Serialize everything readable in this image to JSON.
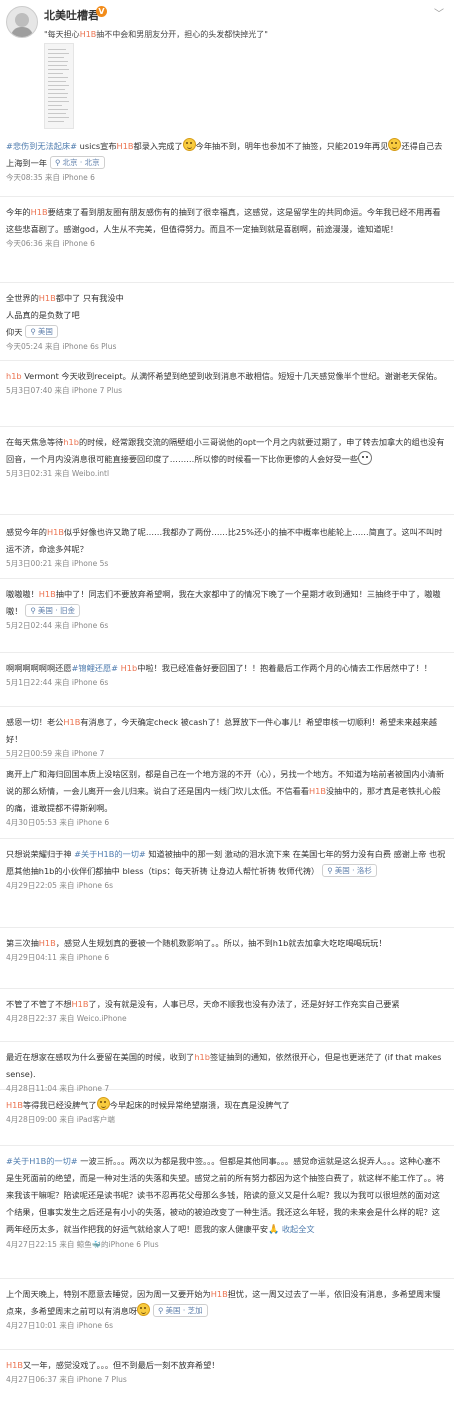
{
  "header": {
    "username": "北美吐槽君",
    "verified_badge": "V",
    "quote_before": "\"每天担心",
    "quote_highlight": "H1B",
    "quote_after": "抽不中会和男朋友分开，担心的头发都快掉光了\""
  },
  "posts": [
    {
      "parts": [
        {
          "t": "#悲伤到无法起床#",
          "c": "topic"
        },
        {
          "t": " usics宣布"
        },
        {
          "t": "H1B",
          "c": "tag"
        },
        {
          "t": "都录入完成了"
        },
        {
          "emoji": "sad"
        },
        {
          "t": "今年抽不到，明年也参加不了抽签，只能2019年再见"
        },
        {
          "emoji": "sad"
        },
        {
          "t": "还得自己去上海到一年"
        }
      ],
      "location": "北京 · 北京",
      "meta": "今天08:35 来自 iPhone 6"
    },
    {
      "parts": [
        {
          "t": "今年的"
        },
        {
          "t": "H1B",
          "c": "tag"
        },
        {
          "t": "要结束了看到朋友圈有朋友感伤有的抽到了很幸福真，这感觉，这是留学生的共同命运。今年我已经不用再看这些悲喜剧了。感谢god，人生从不完美，但值得努力。而且不一定抽到就是喜剧啊，前途漫漫，谁知道呢！"
        }
      ],
      "meta": "今天06:36 来自 iPhone 6"
    },
    {
      "parts": [
        {
          "t": "全世界的"
        },
        {
          "t": "H1B",
          "c": "tag"
        },
        {
          "t": "都中了 只有我没中\n人品真的是负数了吧\n仰天"
        }
      ],
      "location": "美国",
      "meta": "今天05:24 来自 iPhone 6s Plus"
    },
    {
      "parts": [
        {
          "t": "h1b",
          "c": "tag"
        },
        {
          "t": " Vermont 今天收到receipt。从满怀希望到绝望到收到消息不敢相信。短短十几天感觉像半个世纪。谢谢老天保佑。"
        }
      ],
      "meta": "5月3日07:40 来自 iPhone 7 Plus"
    },
    {
      "parts": [
        {
          "t": "在每天焦急等待"
        },
        {
          "t": "h1b",
          "c": "tag"
        },
        {
          "t": "的时候，经常跟我交流的隔壁组小三哥说他的opt一个月之内就要过期了，申了转去加拿大的组也没有回音，一个月内没消息很可能直接要回印度了………所以惨的时候看一下比你更惨的人会好受一些"
        },
        {
          "emoji": "face"
        }
      ],
      "meta": "5月3日02:31 来自 Weibo.intl"
    },
    {
      "parts": [
        {
          "t": "感觉今年的"
        },
        {
          "t": "H1B",
          "c": "tag"
        },
        {
          "t": "似乎好像也许又跪了呢……我都办了两份……比25%还小的抽不中概率也能轮上……简直了。这叫不叫时运不济，命途多舛呢？"
        }
      ],
      "meta": "5月3日00:21 来自 iPhone 5s"
    },
    {
      "parts": [
        {
          "t": "嗷嗷嗷！"
        },
        {
          "t": "H1B",
          "c": "tag"
        },
        {
          "t": "抽中了！同志们不要放弃希望啊，我在大家都中了的情况下晚了一个星期才收到通知！三抽终于中了，嗷嗷嗷！"
        }
      ],
      "location": "美国 · 旧金",
      "meta": "5月2日02:44 来自 iPhone 6s"
    },
    {
      "parts": [
        {
          "t": "啊啊啊啊啊啊还愿"
        },
        {
          "t": "#锦鲤还愿#",
          "c": "topic"
        },
        {
          "t": " "
        },
        {
          "t": "H1b",
          "c": "tag"
        },
        {
          "t": "中啦！我已经准备好要回国了！！抱着最后工作两个月的心情去工作居然中了！！"
        }
      ],
      "meta": "5月1日22:44 来自 iPhone 6s"
    },
    {
      "parts": [
        {
          "t": "感恩一切！老公"
        },
        {
          "t": "H1B",
          "c": "tag"
        },
        {
          "t": "有消息了，今天确定check 被cash了！总算放下一件心事儿！希望审核一切顺利！希望未来越来越好！"
        }
      ],
      "meta": "5月2日00:59 来自 iPhone 7"
    },
    {
      "parts": [
        {
          "t": "离开上广和海归回国本质上没啥区别，都是自己在一个地方混的不开（心），另找一个地方。不知道为啥前者被国内小清新说的那么矫情，一会儿离开一会儿归来。说白了还是国内一线门坎儿太低。不信看看"
        },
        {
          "t": "H1B",
          "c": "tag"
        },
        {
          "t": "没抽中的，那才真是老铁扎心般的痛，谁敢提都不得斯剁啊。"
        }
      ],
      "meta": "4月30日05:53 来自 iPhone 6"
    },
    {
      "parts": [
        {
          "t": "只想说荣耀归于神 "
        },
        {
          "t": "#关于H1B的一切#",
          "c": "topic"
        },
        {
          "t": " 知道被抽中的那一刻 激动的泪水流下来 在美国七年的努力没有白费 感谢上帝 也祝愿其他抽h1b的小伙伴们都抽中 bless（tips：每天祈祷 让身边人帮忙祈祷 牧师代祷）"
        }
      ],
      "location": "美国 · 洛杉",
      "meta": "4月29日22:05 来自 iPhone 6s"
    },
    {
      "parts": [
        {
          "t": "第三次抽"
        },
        {
          "t": "H1B",
          "c": "tag"
        },
        {
          "t": "，感觉人生规划真的要被一个随机数影响了。。所以，抽不到h1b就去加拿大吃吃喝喝玩玩！"
        }
      ],
      "meta": "4月29日04:11 来自 iPhone 6"
    },
    {
      "parts": [
        {
          "t": "不管了不管了不想"
        },
        {
          "t": "H1B",
          "c": "tag"
        },
        {
          "t": "了，没有就是没有，人事已尽，天命不顺我也没有办法了，还是好好工作充实自己要紧"
        }
      ],
      "meta": "4月28日22:37 来自 Weico.iPhone"
    },
    {
      "parts": [
        {
          "t": "最近在想家在感叹为什么要留在美国的时候，收到了"
        },
        {
          "t": "h1b",
          "c": "tag"
        },
        {
          "t": "签证抽到的通知，依然很开心，但是也更迷茫了 (if that makes sense)."
        }
      ],
      "meta": "4月28日11:04 来自 iPhone 7"
    },
    {
      "parts": [
        {
          "t": "H1B",
          "c": "tag"
        },
        {
          "t": "等得我已经没脾气了"
        },
        {
          "emoji": "sad"
        },
        {
          "t": "今早起床的时候异常绝望崩溃，现在真是没脾气了"
        }
      ],
      "meta": "4月28日09:00 来自 iPad客户端"
    },
    {
      "parts": [
        {
          "t": "#关于H1B的一切#",
          "c": "topic"
        },
        {
          "t": " 一波三折。。。两次以为都是我中签。。。但都是其他同事。。。感觉命运就是这么捉弄人。。。这种心塞不是生死面前的绝望，而是一种对生活的失落和失望。感觉之前的所有努力都因为这个抽签白费了，就这样不能工作了。。将来我该干嘛呢？陪读呢还是读书呢？读书不忍再花父母那么多钱，陪读的意义又是什么呢？我以为我可以很坦然的面对这个结果，但事实发生之后还是有小小的失落，被动的被迫改变了一种生活。我还这么年轻，我的未来会是什么样的呢？这两年经历太多，就当作把我的好运气就给家人了吧！愿我的家人健康平安"
        },
        {
          "emoji": "pray"
        },
        {
          "t": " "
        },
        {
          "t": "收起全文",
          "c": "expand"
        }
      ],
      "meta": "4月27日22:15 来自 鲸鱼🐳的iPhone 6 Plus"
    },
    {
      "parts": [
        {
          "t": "上个周天晚上，特别不愿意去睡觉，因为周一又要开始为"
        },
        {
          "t": "H1B",
          "c": "tag"
        },
        {
          "t": "担忧，这一周又过去了一半，依旧没有消息，多希望周末慢点来，多希望周末之前可以有消息呀"
        },
        {
          "emoji": "sad"
        }
      ],
      "location": "美国 · 芝加",
      "meta": "4月27日10:01 来自 iPhone 6s"
    },
    {
      "parts": [
        {
          "t": "H1B",
          "c": "tag"
        },
        {
          "t": "又一年，感觉没戏了。。。但不到最后一刻不放弃希望！"
        }
      ],
      "meta": "4月27日06:37 来自 iPhone 7 Plus"
    }
  ],
  "icons": {
    "location": "location-pin-icon",
    "chevron": "chevron-down-icon"
  },
  "colors": {
    "keyword": "#eb7350",
    "topic": "#507daf",
    "meta": "#888888"
  }
}
